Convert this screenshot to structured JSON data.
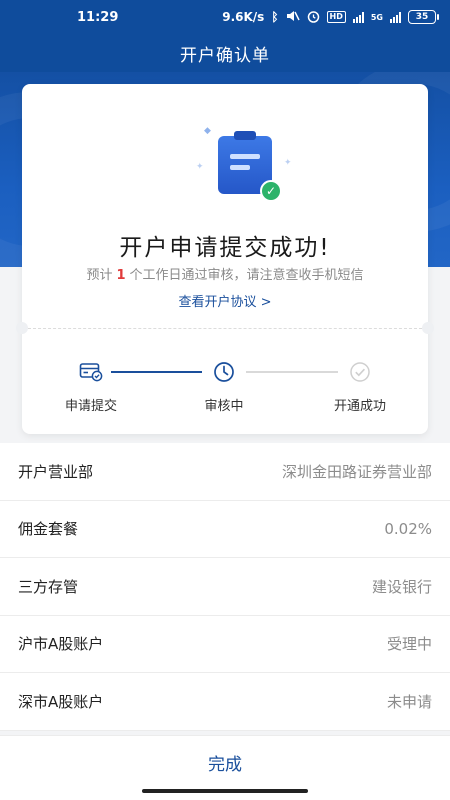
{
  "status_bar": {
    "time": "11:29",
    "net_speed": "9.6K/s",
    "battery": "35",
    "hd_label": "HD",
    "network_label": "5G"
  },
  "header": {
    "title": "开户确认单"
  },
  "result": {
    "title": "开户申请提交成功!",
    "notice_prefix": "预计",
    "notice_days": "1",
    "notice_suffix": "个工作日通过审核，请注意查收手机短信",
    "agreement_link": "查看开户协议 >"
  },
  "steps": [
    {
      "label": "申请提交",
      "state": "done"
    },
    {
      "label": "审核中",
      "state": "current"
    },
    {
      "label": "开通成功",
      "state": "pending"
    }
  ],
  "info": [
    {
      "key": "开户营业部",
      "value": "深圳金田路证券营业部"
    },
    {
      "key": "佣金套餐",
      "value": "0.02%"
    },
    {
      "key": "三方存管",
      "value": "建设银行"
    },
    {
      "key": "沪市A股账户",
      "value": "受理中"
    },
    {
      "key": "深市A股账户",
      "value": "未申请"
    }
  ],
  "footer": {
    "done_label": "完成"
  },
  "colors": {
    "primary": "#0f4c9c",
    "accent_link": "#1a4f9c",
    "success": "#2db36a",
    "highlight": "#e03b3b"
  },
  "icons": {
    "step1": "card-check-icon",
    "step2": "clock-icon",
    "step3": "check-circle-icon"
  }
}
